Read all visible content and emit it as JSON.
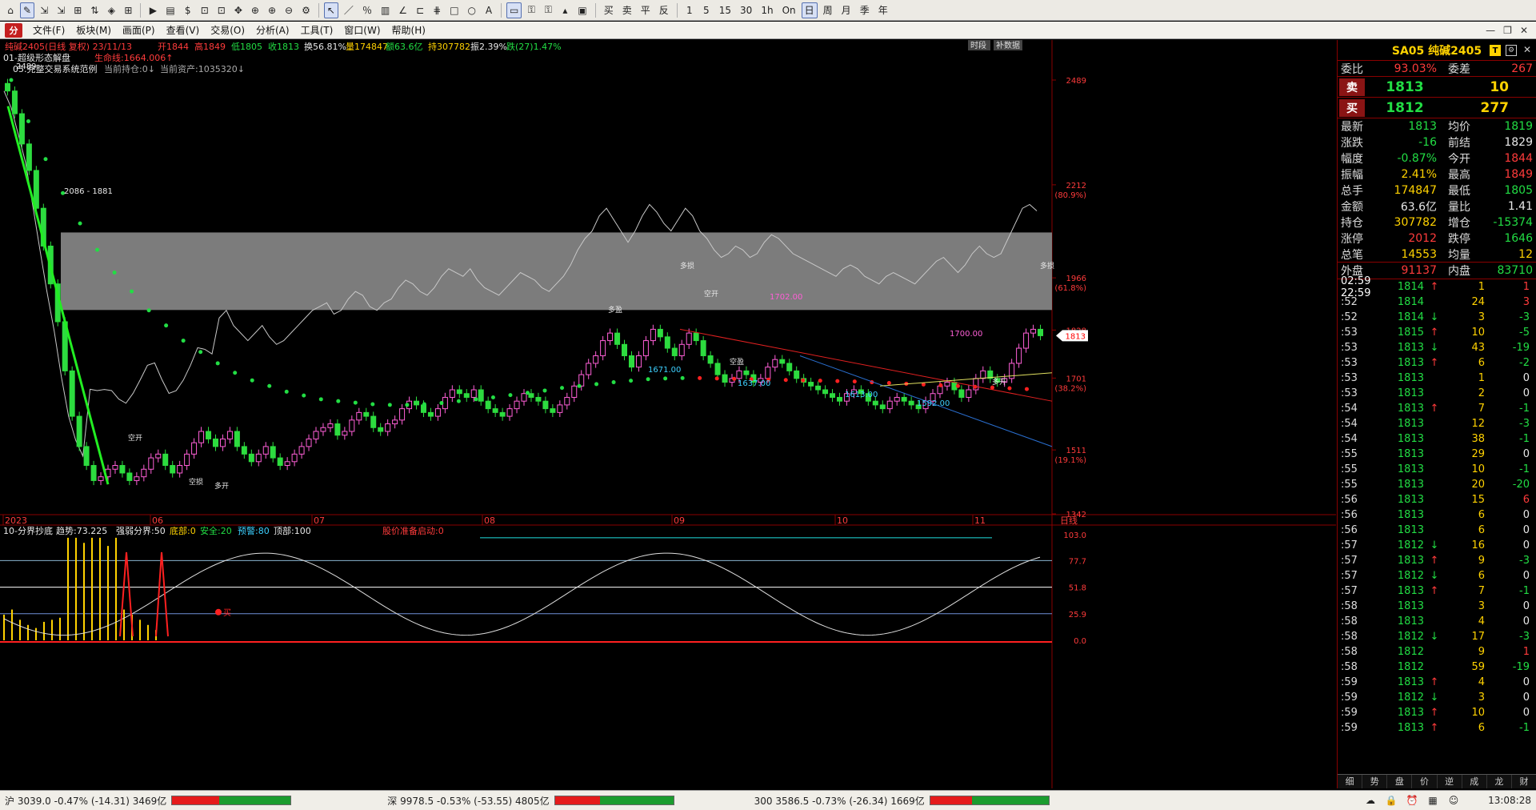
{
  "toolbar": {
    "items": [
      "⌂",
      "✎",
      "⇲",
      "⇲",
      "⊞",
      "⇅",
      "◈",
      "⊞",
      "▶",
      "▤",
      "$",
      "⊡",
      "⊡",
      "✥",
      "⊕",
      "⊕",
      "⊖",
      "⚙",
      "↖",
      "／",
      "％",
      "▥",
      "∠",
      "⊏",
      "⋕",
      "□",
      "○",
      "A",
      "▭",
      "⚿",
      "⚿",
      "▴",
      "▣"
    ],
    "text_items": [
      "买",
      "卖",
      "平",
      "反"
    ],
    "periods": [
      "1",
      "5",
      "15",
      "30",
      "1h",
      "On",
      "日",
      "周",
      "月",
      "季",
      "年"
    ]
  },
  "menu": {
    "logo": "分",
    "items": [
      "文件(F)",
      "板块(M)",
      "画面(P)",
      "查看(V)",
      "交易(O)",
      "分析(A)",
      "工具(T)",
      "窗口(W)",
      "帮助(H)"
    ],
    "win": [
      "—",
      "❐",
      "✕"
    ]
  },
  "header": {
    "symbol": "纯碱2405(日线 复权) 23/11/13",
    "open": "开1844",
    "high": "高1849",
    "low": "低1805",
    "close": "收1813",
    "turnover": "换56.81%",
    "volume": "量174847",
    "amount": "额63.6亿",
    "oi": "持307782",
    "amplitude": "振2.39%",
    "change": "跌(27)1.47%",
    "indicator": "01-超级形态解盘",
    "life_line": "生命线:1664.006↑",
    "system": "05.完整交易系统范例",
    "pos": "当前持仓:0↓",
    "asset": "当前资产:1035320↓",
    "btn_time": "时段",
    "btn_fill": "补数据"
  },
  "chart_data": {
    "type": "candlestick",
    "y_min": 1342,
    "y_max": 2489,
    "y_ticks": [
      "2489",
      "2212",
      "1966",
      "1828",
      "1701",
      "1511",
      "1342"
    ],
    "y_pct": [
      "(80.9%)",
      "(61.8%)",
      "(38.2%)",
      "(19.1%)"
    ],
    "x_labels": [
      "2023",
      "06",
      "07",
      "08",
      "09",
      "10",
      "11",
      "日线"
    ],
    "annotations": [
      "2489",
      "2086 - 1881",
      "1671.00",
      "1637.00",
      "1613.00",
      "1592.00",
      "1702.00",
      "1700.00"
    ],
    "markers": [
      "空开",
      "多开",
      "多盈",
      "多损",
      "空损",
      "空盈",
      "多开",
      "空开",
      "多损"
    ],
    "price_tag": "1813",
    "close_series": [
      2460,
      2400,
      2320,
      2250,
      2150,
      2050,
      1950,
      1850,
      1720,
      1600,
      1520,
      1470,
      1430,
      1440,
      1460,
      1470,
      1450,
      1430,
      1440,
      1460,
      1490,
      1500,
      1470,
      1450,
      1470,
      1500,
      1530,
      1560,
      1540,
      1520,
      1540,
      1560,
      1520,
      1500,
      1480,
      1500,
      1520,
      1490,
      1470,
      1480,
      1500,
      1520,
      1540,
      1560,
      1570,
      1580,
      1550,
      1560,
      1590,
      1610,
      1600,
      1570,
      1560,
      1580,
      1590,
      1620,
      1640,
      1630,
      1610,
      1600,
      1620,
      1650,
      1670,
      1660,
      1650,
      1670,
      1640,
      1620,
      1610,
      1600,
      1620,
      1640,
      1660,
      1650,
      1640,
      1620,
      1610,
      1630,
      1650,
      1680,
      1710,
      1740,
      1760,
      1800,
      1820,
      1790,
      1760,
      1730,
      1760,
      1800,
      1830,
      1810,
      1780,
      1760,
      1790,
      1820,
      1800,
      1760,
      1740,
      1710,
      1690,
      1700,
      1720,
      1710,
      1690,
      1700,
      1730,
      1750,
      1740,
      1720,
      1700,
      1690,
      1680,
      1670,
      1660,
      1650,
      1640,
      1660,
      1670,
      1660,
      1640,
      1630,
      1620,
      1640,
      1650,
      1640,
      1630,
      1620,
      1640,
      1660,
      1680,
      1690,
      1670,
      1650,
      1670,
      1700,
      1720,
      1700,
      1690,
      1700,
      1740,
      1780,
      1820,
      1830,
      1813
    ],
    "life_line": [
      2489,
      2380,
      2280,
      2190,
      2110,
      2040,
      1980,
      1930,
      1880,
      1840,
      1800,
      1770,
      1740,
      1715,
      1695,
      1680,
      1665,
      1655,
      1645,
      1640,
      1636,
      1632,
      1630,
      1630,
      1632,
      1635,
      1640,
      1645,
      1650,
      1656,
      1662,
      1668,
      1675,
      1680,
      1685,
      1690,
      1694,
      1698,
      1700,
      1701,
      1701,
      1700,
      1699,
      1698,
      1697,
      1696,
      1695,
      1694,
      1693,
      1692,
      1690,
      1688,
      1686,
      1684,
      1682,
      1680,
      1678,
      1676,
      1674,
      1672
    ],
    "zone": [
      1881,
      2086
    ]
  },
  "indicator": {
    "title": "10-分界抄底",
    "trend": "趋势:73.225",
    "strong": "强弱分界:50",
    "bottom": "底部:0",
    "safe": "安全:20",
    "warn": "预警:80",
    "top": "顶部:100",
    "alert": "股价准备启动:0",
    "y_ticks": [
      "103.0",
      "77.7",
      "51.8",
      "25.9",
      "0.0"
    ],
    "buy_tag": "买"
  },
  "side": {
    "title": "SA05 纯碱2405",
    "fb": "T",
    "fb2": "⚙",
    "close_x": "✕",
    "ratio": {
      "l": "委比",
      "v": "93.03%",
      "l2": "委差",
      "v2": "267"
    },
    "sell": {
      "l": "卖",
      "p": "1813",
      "v": "10"
    },
    "buy": {
      "l": "买",
      "p": "1812",
      "v": "277"
    },
    "rows": [
      [
        "最新",
        "1813",
        "均价",
        "1819"
      ],
      [
        "涨跌",
        "-16",
        "前结",
        "1829"
      ],
      [
        "幅度",
        "-0.87%",
        "今开",
        "1844"
      ],
      [
        "振幅",
        "2.41%",
        "最高",
        "1849"
      ],
      [
        "总手",
        "174847",
        "最低",
        "1805"
      ],
      [
        "金额",
        "63.6亿",
        "量比",
        "1.41"
      ],
      [
        "持仓",
        "307782",
        "增仓",
        "-15374"
      ],
      [
        "涨停",
        "2012",
        "跌停",
        "1646"
      ],
      [
        "总笔",
        "14553",
        "均量",
        "12"
      ],
      [
        "外盘",
        "91137",
        "内盘",
        "83710"
      ]
    ],
    "trades": [
      [
        "02:59 22:59",
        "1814",
        "↑",
        "1",
        "1"
      ],
      [
        ":52",
        "1814",
        "",
        "24",
        "3"
      ],
      [
        ":52",
        "1814",
        "↓",
        "3",
        "-3"
      ],
      [
        ":53",
        "1815",
        "↑",
        "10",
        "-5"
      ],
      [
        ":53",
        "1813",
        "↓",
        "43",
        "-19"
      ],
      [
        ":53",
        "1813",
        "↑",
        "6",
        "-2"
      ],
      [
        ":53",
        "1813",
        "",
        "1",
        "0"
      ],
      [
        ":53",
        "1813",
        "",
        "2",
        "0"
      ],
      [
        ":54",
        "1813",
        "↑",
        "7",
        "-1"
      ],
      [
        ":54",
        "1813",
        "",
        "12",
        "-3"
      ],
      [
        ":54",
        "1813",
        "",
        "38",
        "-1"
      ],
      [
        ":55",
        "1813",
        "",
        "29",
        "0"
      ],
      [
        ":55",
        "1813",
        "",
        "10",
        "-1"
      ],
      [
        ":55",
        "1813",
        "",
        "20",
        "-20"
      ],
      [
        ":56",
        "1813",
        "",
        "15",
        "6"
      ],
      [
        ":56",
        "1813",
        "",
        "6",
        "0"
      ],
      [
        ":56",
        "1813",
        "",
        "6",
        "0"
      ],
      [
        ":57",
        "1812",
        "↓",
        "16",
        "0"
      ],
      [
        ":57",
        "1813",
        "↑",
        "9",
        "-3"
      ],
      [
        ":57",
        "1812",
        "↓",
        "6",
        "0"
      ],
      [
        ":57",
        "1813",
        "↑",
        "7",
        "-1"
      ],
      [
        ":58",
        "1813",
        "",
        "3",
        "0"
      ],
      [
        ":58",
        "1813",
        "",
        "4",
        "0"
      ],
      [
        ":58",
        "1812",
        "↓",
        "17",
        "-3"
      ],
      [
        ":58",
        "1812",
        "",
        "9",
        "1"
      ],
      [
        ":58",
        "1812",
        "",
        "59",
        "-19"
      ],
      [
        ":59",
        "1813",
        "↑",
        "4",
        "0"
      ],
      [
        ":59",
        "1812",
        "↓",
        "3",
        "0"
      ],
      [
        ":59",
        "1813",
        "↑",
        "10",
        "0"
      ],
      [
        ":59",
        "1813",
        "↑",
        "6",
        "-1"
      ]
    ],
    "tabs": [
      "细",
      "势",
      "盘",
      "价",
      "逆",
      "成",
      "龙",
      "财"
    ]
  },
  "status": {
    "sh": "沪 3039.0 -0.47% (-14.31) 3469亿",
    "sz": "深 9978.5 -0.53% (-53.55) 4805亿",
    "hs": "300 3586.5 -0.73% (-26.34) 1669亿",
    "time": "13:08:28"
  }
}
